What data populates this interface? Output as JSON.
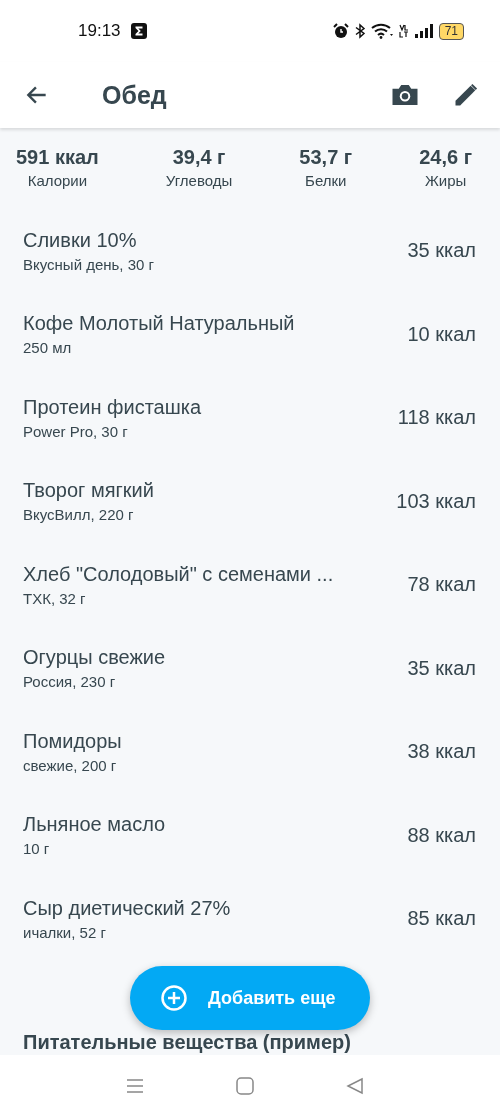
{
  "status_bar": {
    "time": "19:13",
    "battery": "71"
  },
  "header": {
    "title": "Обед"
  },
  "summary": [
    {
      "value": "591 ккал",
      "label": "Калории"
    },
    {
      "value": "39,4 г",
      "label": "Углеводы"
    },
    {
      "value": "53,7 г",
      "label": "Белки"
    },
    {
      "value": "24,6 г",
      "label": "Жиры"
    }
  ],
  "items": [
    {
      "name": "Сливки 10%",
      "detail": "Вкусный день, 30 г",
      "calories": "35 ккал"
    },
    {
      "name": "Кофе Молотый Натуральный",
      "detail": "250 мл",
      "calories": "10 ккал"
    },
    {
      "name": "Протеин фисташка",
      "detail": "Power Pro, 30 г",
      "calories": "118 ккал"
    },
    {
      "name": "Творог мягкий",
      "detail": "ВкусВилл, 220 г",
      "calories": "103 ккал"
    },
    {
      "name": "Хлеб \"Солодовый\" с семенами ...",
      "detail": "ТХК, 32 г",
      "calories": "78 ккал"
    },
    {
      "name": "Огурцы свежие",
      "detail": "Россия, 230 г",
      "calories": "35 ккал"
    },
    {
      "name": "Помидоры",
      "detail": "свежие, 200 г",
      "calories": "38 ккал"
    },
    {
      "name": "Льняное масло",
      "detail": "10 г",
      "calories": "88 ккал"
    },
    {
      "name": "Сыр диетический 27%",
      "detail": "ичалки, 52 г",
      "calories": "85 ккал"
    }
  ],
  "section_heading": "Питательные вещества (пример)",
  "add_button": {
    "label": "Добавить еще"
  }
}
